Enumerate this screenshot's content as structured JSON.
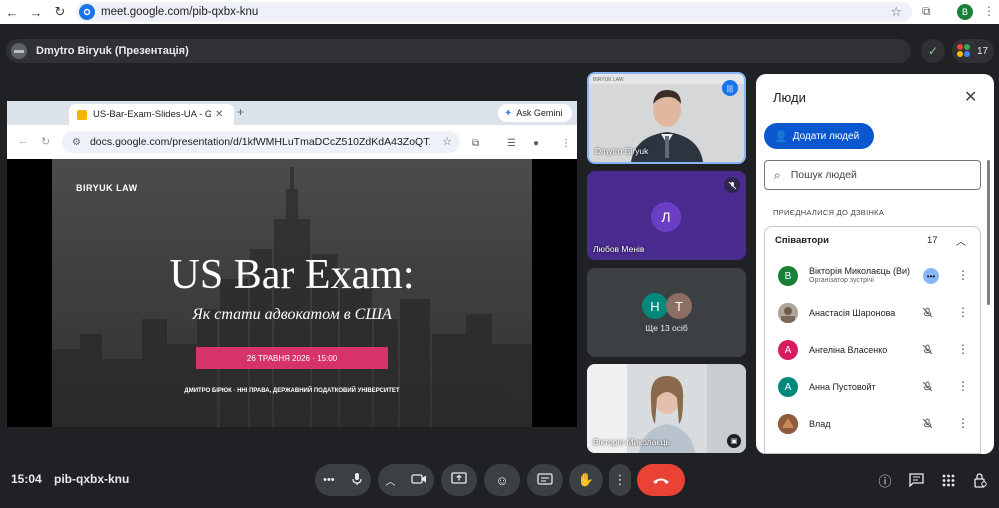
{
  "browser": {
    "url": "meet.google.com/pib-qxbx-knu",
    "profile_initial": "B"
  },
  "meet": {
    "presenter_label": "Dmytro Biryuk (Презентація)",
    "participant_count": "17",
    "clock": "15:04",
    "meeting_code": "pib-qxbx-knu"
  },
  "shared_screen": {
    "tab_title": "US-Bar-Exam-Slides-UA - Go",
    "gemini_label": "Ask Gemini",
    "url": "docs.google.com/presentation/d/1kfWMHLuTmaDCcZ510ZdKdA43ZoQT...",
    "slide": {
      "brand": "BIRYUK LAW",
      "title": "US Bar Exam:",
      "subtitle": "Як стати адвокатом в США",
      "date": "26 ТРАВНЯ 2026 · 15:00",
      "footer": "ДМИТРО БІРЮК · ННІ ПРАВА, ДЕРЖАВНИЙ ПОДАТКОВИЙ УНІВЕРСИТЕТ"
    }
  },
  "tiles": [
    {
      "name": "Dmytro Biryuk",
      "tag": "BIRYUK LAW"
    },
    {
      "name": "Любов Менів",
      "initial": "Л"
    },
    {
      "label": "Ще 13 осіб",
      "initials": [
        "Н",
        "Т"
      ]
    },
    {
      "name": "Вікторія Миколаєць"
    }
  ],
  "people_panel": {
    "title": "Люди",
    "add_button": "Додати людей",
    "search_placeholder": "Пошук людей",
    "section_label": "ПРИЄДНАЛИСЯ ДО ДЗВІНКА",
    "group_label": "Співавтори",
    "group_count": "17",
    "participants": [
      {
        "initial": "В",
        "name": "Вікторія Миколаєць (Ви)",
        "role": "Організатор зустрічі",
        "color": "#188038"
      },
      {
        "initial": "",
        "name": "Анастасія Шаронова",
        "color": "#8d6e63"
      },
      {
        "initial": "А",
        "name": "Ангеліна Власенко",
        "color": "#d81b60"
      },
      {
        "initial": "А",
        "name": "Анна Пустовойт",
        "color": "#00897b"
      },
      {
        "initial": "",
        "name": "Влад",
        "color": "#795548"
      }
    ]
  },
  "colors": {
    "accent": "#1a73e8",
    "end_call": "#ea4335",
    "add_button": "#0b57d0"
  }
}
